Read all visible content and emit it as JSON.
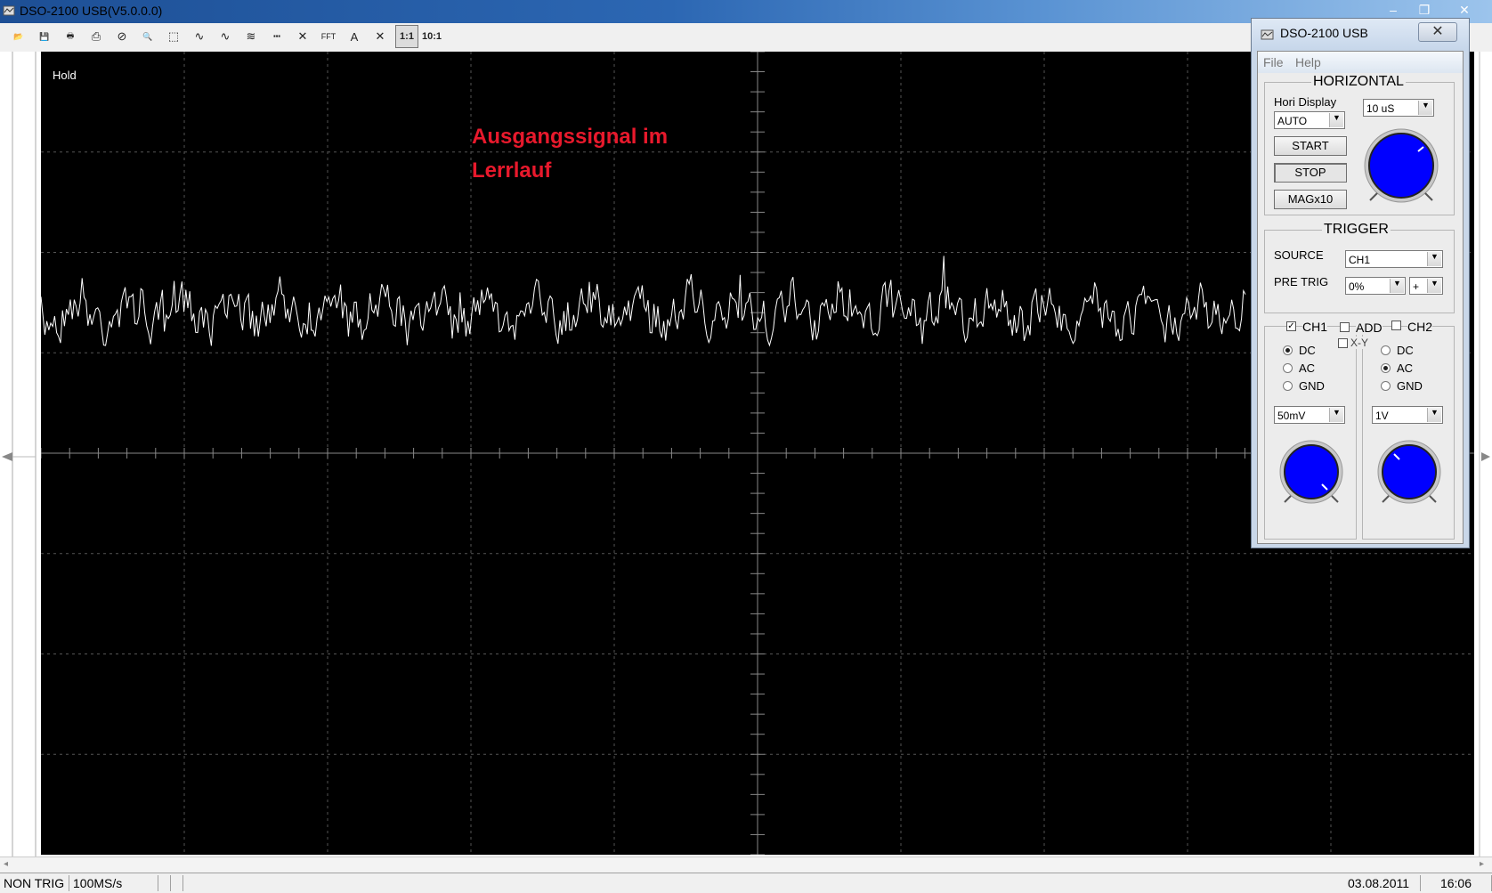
{
  "window": {
    "title": "DSO-2100 USB(V5.0.0.0)",
    "controls": [
      "–",
      "❐",
      "✕"
    ]
  },
  "toolbar": {
    "buttons": [
      {
        "name": "open-icon",
        "glyph": "📂"
      },
      {
        "name": "save-icon",
        "glyph": "💾"
      },
      {
        "name": "print-icon",
        "glyph": "🖶"
      },
      {
        "name": "print-preview-icon",
        "glyph": "⎙"
      },
      {
        "name": "stop-icon",
        "glyph": "⊘"
      },
      {
        "name": "zoom-icon",
        "glyph": "🔍"
      },
      {
        "name": "select-area-icon",
        "glyph": "⬚"
      },
      {
        "name": "wave1-icon",
        "glyph": "∿"
      },
      {
        "name": "wave2-icon",
        "glyph": "∿"
      },
      {
        "name": "filter-icon",
        "glyph": "≋"
      },
      {
        "name": "dashes-icon",
        "glyph": "┅"
      },
      {
        "name": "marker-icon",
        "glyph": "✕"
      },
      {
        "name": "fft-icon",
        "glyph": "FFT"
      },
      {
        "name": "text-icon",
        "glyph": "A"
      },
      {
        "name": "cross-icon",
        "glyph": "✕"
      }
    ],
    "ratio_1": "1:1",
    "ratio_10": "10:1"
  },
  "scope": {
    "hold_label": "Hold",
    "annotation_line1": "Ausgangssignal im",
    "annotation_line2": "Lerrlauf",
    "trace_color": "#ffffff",
    "annotation_color": "#e8192c"
  },
  "status": {
    "trigger": "NON TRIG",
    "sample_rate": "100MS/s",
    "date": "03.08.2011",
    "time": "16:06"
  },
  "panel": {
    "title": "DSO-2100 USB",
    "close": "✕",
    "menu": {
      "file": "File",
      "help": "Help"
    },
    "horizontal": {
      "title": "HORIZONTAL",
      "hori_display_label": "Hori Display",
      "hori_display_value": "AUTO",
      "timebase": "10 uS",
      "start": "START",
      "stop": "STOP",
      "mag": "MAGx10"
    },
    "trigger": {
      "title": "TRIGGER",
      "source_label": "SOURCE",
      "source_value": "CH1",
      "pretrig_label": "PRE TRIG",
      "pretrig_value": "0%",
      "slope_value": "+"
    },
    "channels": {
      "ch1_label": "CH1",
      "ch1_checked": "✓",
      "add_label": "ADD",
      "ch2_label": "CH2",
      "xy_label": "X-Y",
      "ch1_coupling": {
        "dc": "DC",
        "ac": "AC",
        "gnd": "GND"
      },
      "ch2_coupling": {
        "dc": "DC",
        "ac": "AC",
        "gnd": "GND"
      },
      "ch1_volts": "50mV",
      "ch2_volts": "1V"
    },
    "knob_color": "#0000ff"
  }
}
